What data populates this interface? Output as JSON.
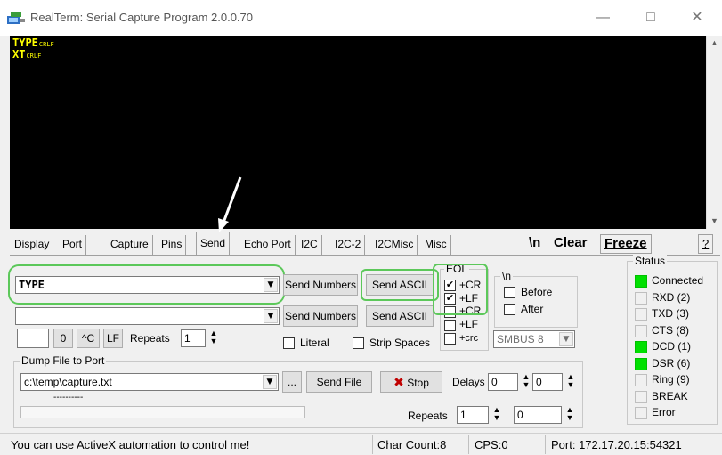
{
  "window": {
    "title": "RealTerm: Serial Capture Program 2.0.0.70",
    "minimize": "—",
    "maximize": "□",
    "close": "✕"
  },
  "terminal": {
    "lines": [
      "TYPE",
      "XT"
    ],
    "line_end": "CRLF",
    "text_color": "#ffff00",
    "bg_color": "#000000"
  },
  "tabs": [
    {
      "label": "Display"
    },
    {
      "label": "Port"
    },
    {
      "label": "Capture"
    },
    {
      "label": "Pins"
    },
    {
      "label": "Send",
      "active": true
    },
    {
      "label": "Echo Port"
    },
    {
      "label": "I2C"
    },
    {
      "label": "I2C-2"
    },
    {
      "label": "I2CMisc"
    },
    {
      "label": "Misc"
    }
  ],
  "toolbar": {
    "newline_btn": "\\n",
    "clear_btn": "Clear",
    "freeze_btn": "Freeze",
    "help_btn": "?"
  },
  "send": {
    "line1_value": "TYPE",
    "line2_value": "",
    "send_numbers_1": "Send Numbers",
    "send_ascii_1": "Send ASCII",
    "send_numbers_2": "Send Numbers",
    "send_ascii_2": "Send ASCII",
    "zero_btn": "0",
    "ctrlc_btn": "^C",
    "lf_btn": "LF",
    "repeats_label": "Repeats",
    "repeats_value": "1",
    "literal_label": "Literal",
    "strip_spaces_label": "Strip Spaces"
  },
  "eol": {
    "title": "EOL",
    "cr1": {
      "label": "+CR",
      "checked": true
    },
    "lf1": {
      "label": "+LF",
      "checked": true
    },
    "cr2": {
      "label": "+CR",
      "checked": false
    },
    "lf2": {
      "label": "+LF",
      "checked": false
    },
    "crc": {
      "label": "+crc",
      "checked": false
    }
  },
  "newline_group": {
    "title": "\\n",
    "before_label": "Before",
    "after_label": "After"
  },
  "smbus": {
    "value": "SMBUS 8"
  },
  "dump": {
    "title": "Dump File to Port",
    "path": "c:\\temp\\capture.txt",
    "browse_btn": "...",
    "send_file_btn": "Send File",
    "stop_btn": "Stop",
    "delays_label": "Delays",
    "delay1": "0",
    "delay2": "0",
    "repeats_label": "Repeats",
    "repeats1": "1",
    "repeats2": "0",
    "progress_text": "----------"
  },
  "status": {
    "title": "Status",
    "items": [
      {
        "label": "Connected",
        "on": true
      },
      {
        "label": "RXD (2)",
        "on": false
      },
      {
        "label": "TXD (3)",
        "on": false
      },
      {
        "label": "CTS (8)",
        "on": false
      },
      {
        "label": "DCD (1)",
        "on": true
      },
      {
        "label": "DSR (6)",
        "on": true
      },
      {
        "label": "Ring (9)",
        "on": false
      },
      {
        "label": "BREAK",
        "on": false
      },
      {
        "label": "Error",
        "on": false
      }
    ]
  },
  "statusbar": {
    "message": "You can use ActiveX automation to control me!",
    "char_count": "Char Count:8",
    "cps": "CPS:0",
    "port": "Port: 172.17.20.15:54321"
  },
  "colors": {
    "highlight": "#5cc85a",
    "led_on": "#00e000"
  }
}
